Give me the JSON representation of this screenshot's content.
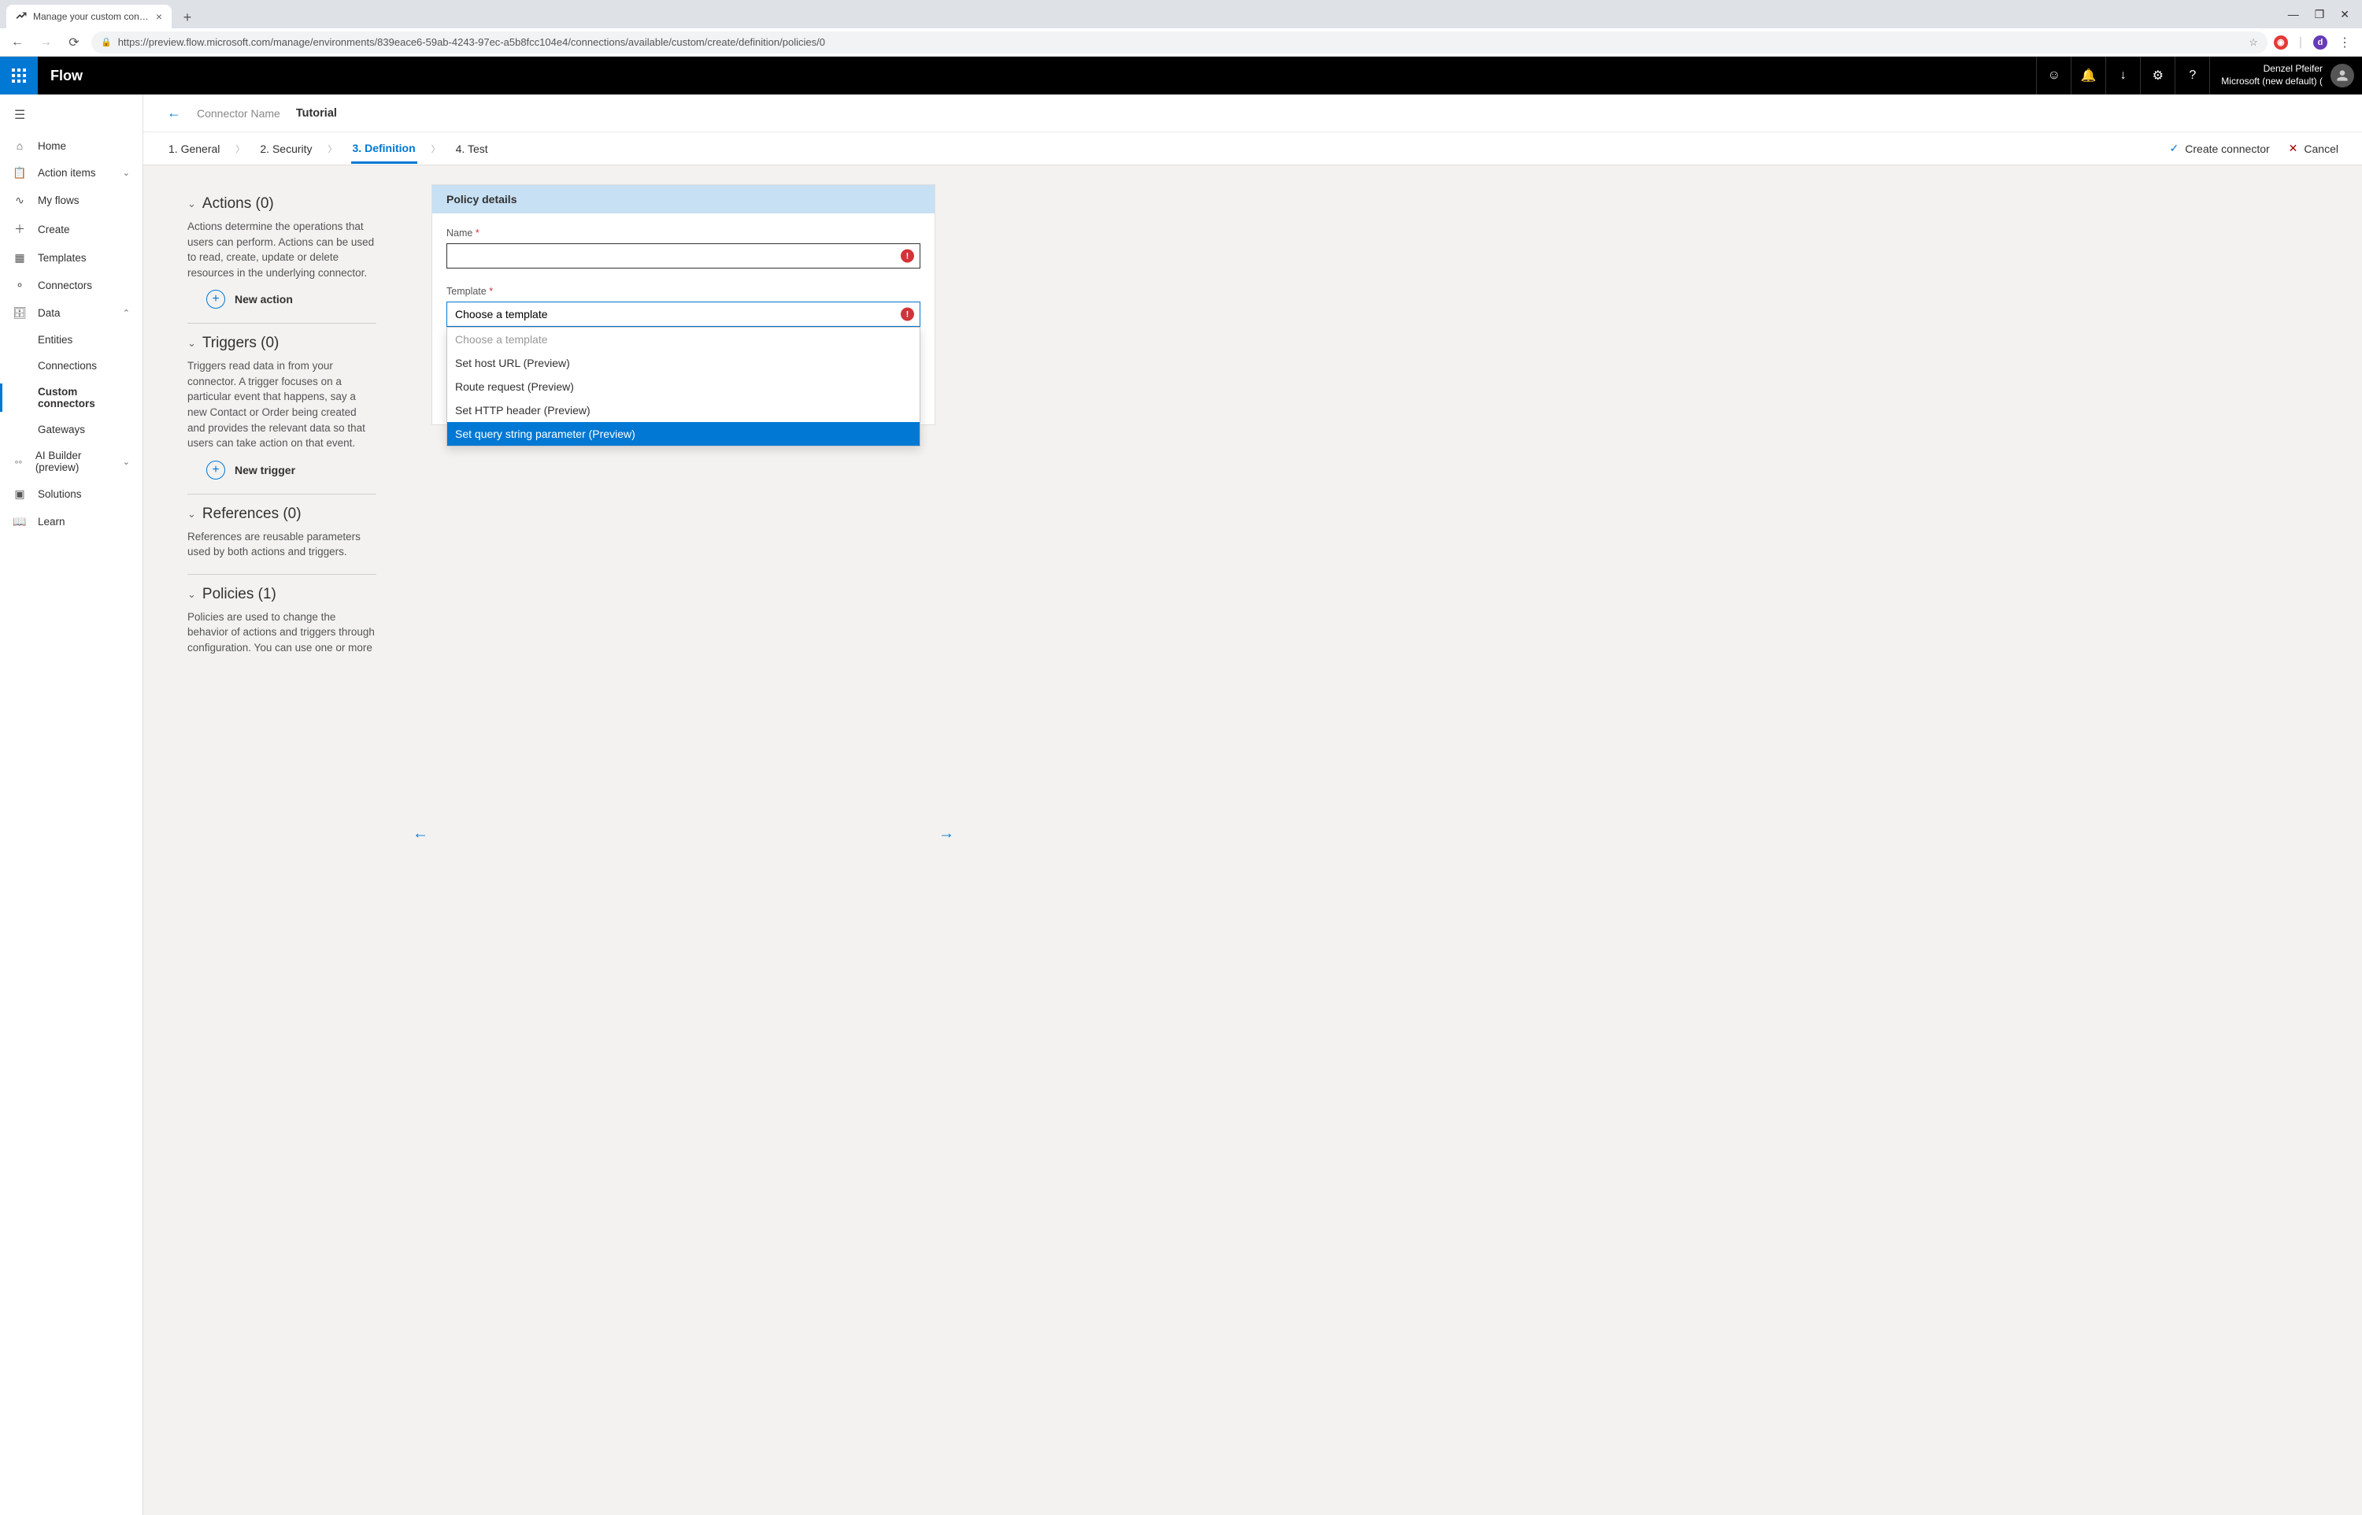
{
  "browser": {
    "tab_title": "Manage your custom connectors",
    "url": "https://preview.flow.microsoft.com/manage/environments/839eace6-59ab-4243-97ec-a5b8fcc104e4/connections/available/custom/create/definition/policies/0"
  },
  "header": {
    "brand": "Flow",
    "user_name": "Denzel Pfeifer",
    "tenant": "Microsoft (new default) ("
  },
  "sidenav": {
    "home": "Home",
    "action_items": "Action items",
    "my_flows": "My flows",
    "create": "Create",
    "templates": "Templates",
    "connectors": "Connectors",
    "data": "Data",
    "entities": "Entities",
    "connections": "Connections",
    "custom_connectors": "Custom connectors",
    "gateways": "Gateways",
    "ai_builder": "AI Builder (preview)",
    "solutions": "Solutions",
    "learn": "Learn"
  },
  "pagehdr": {
    "connector_label": "Connector Name",
    "connector_name": "Tutorial"
  },
  "steps": {
    "s1": "1. General",
    "s2": "2. Security",
    "s3": "3. Definition",
    "s4": "4. Test",
    "create": "Create connector",
    "cancel": "Cancel"
  },
  "sections": {
    "actions_title": "Actions (0)",
    "actions_desc": "Actions determine the operations that users can perform. Actions can be used to read, create, update or delete resources in the underlying connector.",
    "new_action": "New action",
    "triggers_title": "Triggers (0)",
    "triggers_desc": "Triggers read data in from your connector. A trigger focuses on a particular event that happens, say a new Contact or Order being created and provides the relevant data so that users can take action on that event.",
    "new_trigger": "New trigger",
    "references_title": "References (0)",
    "references_desc": "References are reusable parameters used by both actions and triggers.",
    "policies_title": "Policies (1)",
    "policies_desc": "Policies are used to change the behavior of actions and triggers through configuration. You can use one or more"
  },
  "policy": {
    "panel_title": "Policy details",
    "name_label": "Name",
    "name_value": "",
    "template_label": "Template",
    "template_value": "Choose a template",
    "options": {
      "placeholder": "Choose a template",
      "o1": "Set host URL (Preview)",
      "o2": "Route request (Preview)",
      "o3": "Set HTTP header (Preview)",
      "o4": "Set query string parameter (Preview)"
    }
  }
}
